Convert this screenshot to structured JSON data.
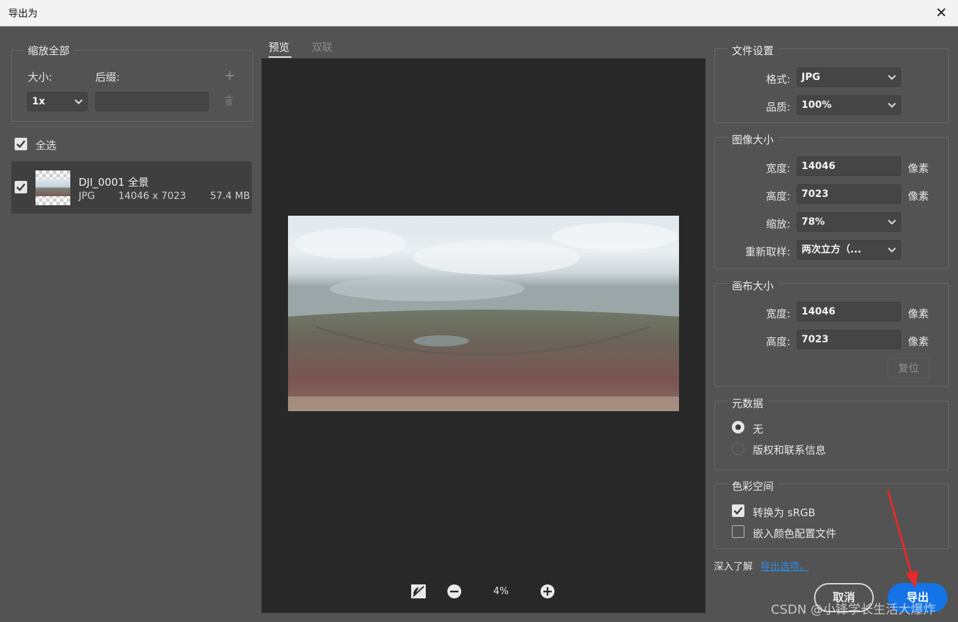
{
  "window": {
    "title": "导出为",
    "close_icon": "close-icon"
  },
  "left": {
    "scale_group": {
      "title": "缩放全部",
      "size_label": "大小:",
      "suffix_label": "后缀:",
      "size_value": "1x",
      "suffix_value": ""
    },
    "select_all": {
      "label": "全选",
      "checked": true
    },
    "item": {
      "name": "DJI_0001 全景",
      "format": "JPG",
      "dimensions": "14046 x 7023",
      "filesize": "57.4 MB",
      "checked": true
    }
  },
  "tabs": [
    {
      "label": "预览",
      "active": true
    },
    {
      "label": "双联",
      "active": false
    }
  ],
  "zoom": {
    "value": "4%"
  },
  "file_settings": {
    "title": "文件设置",
    "format_label": "格式:",
    "format_value": "JPG",
    "quality_label": "品质:",
    "quality_value": "100%"
  },
  "image_size": {
    "title": "图像大小",
    "width_label": "宽度:",
    "width_value": "14046",
    "height_label": "高度:",
    "height_value": "7023",
    "scale_label": "缩放:",
    "scale_value": "78%",
    "resample_label": "重新取样:",
    "resample_value": "两次立方（...",
    "unit": "像素"
  },
  "canvas_size": {
    "title": "画布大小",
    "width_label": "宽度:",
    "width_value": "14046",
    "height_label": "高度:",
    "height_value": "7023",
    "unit": "像素",
    "reset_label": "复位"
  },
  "metadata": {
    "title": "元数据",
    "options": [
      {
        "label": "无",
        "selected": true
      },
      {
        "label": "版权和联系信息",
        "selected": false
      }
    ]
  },
  "color_space": {
    "title": "色彩空间",
    "options": [
      {
        "label": "转换为 sRGB",
        "checked": true
      },
      {
        "label": "嵌入颜色配置文件",
        "checked": false
      }
    ]
  },
  "footer": {
    "learn_more": "深入了解",
    "link": "导出选项。",
    "cancel": "取消",
    "export": "导出"
  },
  "watermark": "CSDN @小锋学长生活大爆炸",
  "colors": {
    "accent": "#1473e6",
    "link": "#2d8ceb",
    "panel": "#535353",
    "preview_bg": "#282828"
  }
}
